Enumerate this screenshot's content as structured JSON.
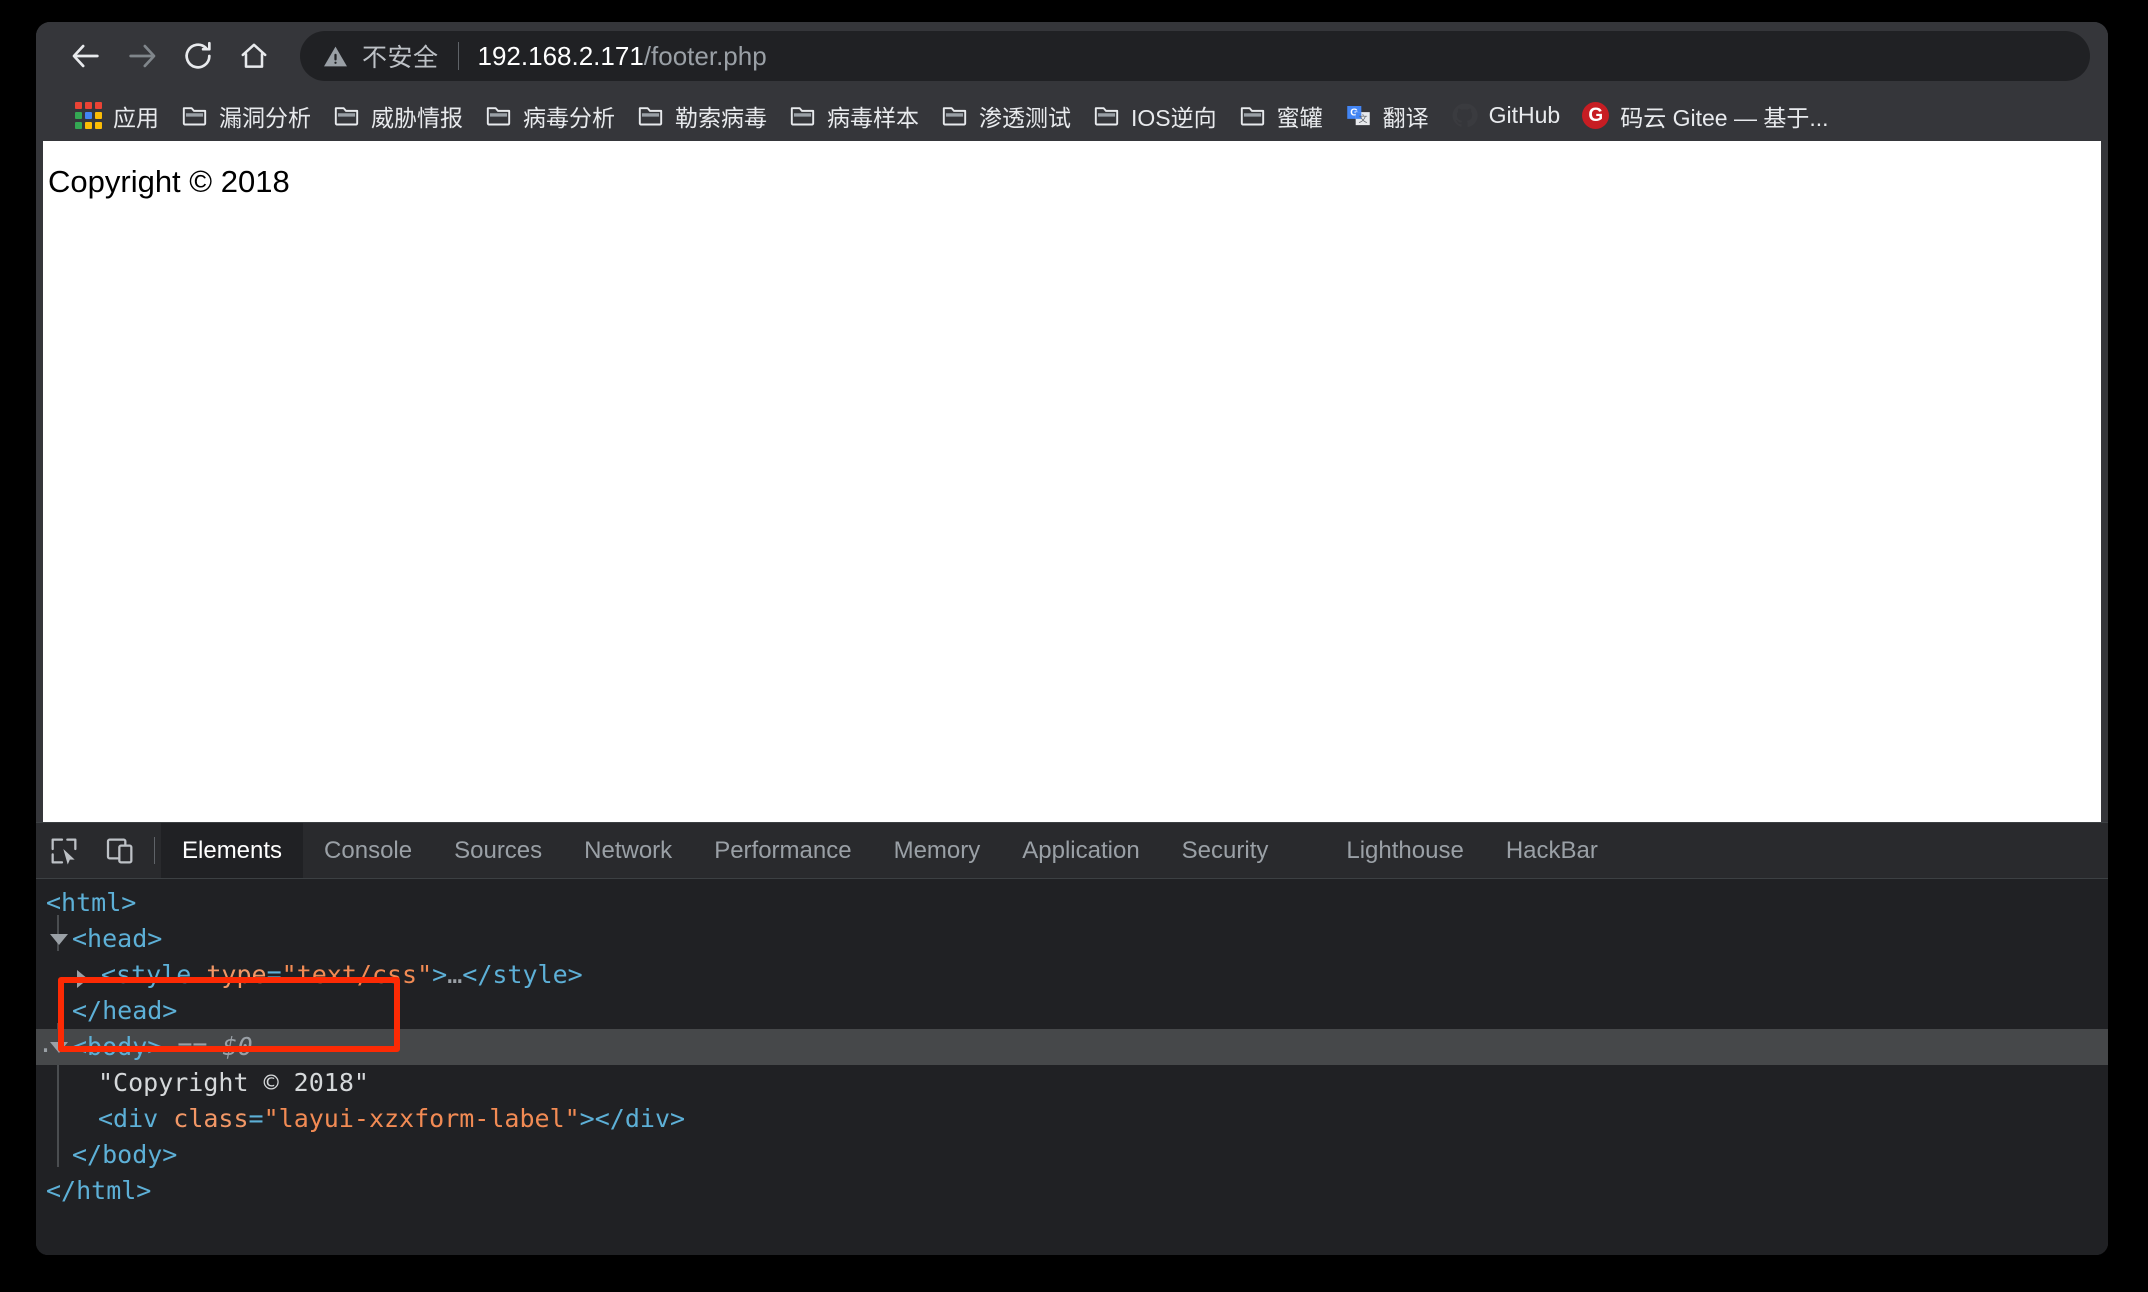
{
  "browser": {
    "nav": {
      "back_label": "Back",
      "forward_label": "Forward",
      "reload_label": "Reload",
      "home_label": "Home"
    },
    "omnibox": {
      "security_icon": "warning-triangle-icon",
      "security_text": "不安全",
      "url_host": "192.168.2.171",
      "url_path": "/footer.php"
    },
    "bookmarks": [
      {
        "label": "应用",
        "icon": "apps-grid-icon"
      },
      {
        "label": "漏洞分析",
        "icon": "folder-icon"
      },
      {
        "label": "威胁情报",
        "icon": "folder-icon"
      },
      {
        "label": "病毒分析",
        "icon": "folder-icon"
      },
      {
        "label": "勒索病毒",
        "icon": "folder-icon"
      },
      {
        "label": "病毒样本",
        "icon": "folder-icon"
      },
      {
        "label": "渗透测试",
        "icon": "folder-icon"
      },
      {
        "label": "IOS逆向",
        "icon": "folder-icon"
      },
      {
        "label": "蜜罐",
        "icon": "folder-icon"
      },
      {
        "label": "翻译",
        "icon": "google-translate-icon"
      },
      {
        "label": "GitHub",
        "icon": "github-icon"
      },
      {
        "label": "码云 Gitee — 基于...",
        "icon": "gitee-icon"
      }
    ]
  },
  "page": {
    "copyright": "Copyright © 2018"
  },
  "devtools": {
    "inspect_icon": "inspect-cursor-icon",
    "device_icon": "device-toolbar-icon",
    "tabs": [
      {
        "label": "Elements",
        "active": true
      },
      {
        "label": "Console",
        "active": false
      },
      {
        "label": "Sources",
        "active": false
      },
      {
        "label": "Network",
        "active": false
      },
      {
        "label": "Performance",
        "active": false
      },
      {
        "label": "Memory",
        "active": false
      },
      {
        "label": "Application",
        "active": false
      },
      {
        "label": "Security",
        "active": false
      },
      {
        "label": "Lighthouse",
        "active": false
      },
      {
        "label": "HackBar",
        "active": false
      }
    ],
    "dom": {
      "row_html_open": "<html>",
      "row_head_open": "<head>",
      "row_style": "<style type=\"text/css\">…</style>",
      "style_tag_open": "<style ",
      "style_attr_name": "type",
      "style_attr_eq": "=",
      "style_attr_value": "\"text/css\"",
      "style_tag_close_gt": ">",
      "style_ellipsis": "…",
      "style_end_tag": "</style>",
      "row_head_close": "</head>",
      "row_body_open": "<body>",
      "row_body_marker": "== $0",
      "row_text_node": "\"Copyright © 2018\"",
      "div_open": "<div ",
      "div_attr_name": "class",
      "div_attr_eq": "=",
      "div_attr_value": "\"layui-xzxform-label\"",
      "div_gt": ">",
      "div_close": "</div>",
      "row_body_close": "</body>",
      "row_html_close": "</html>"
    },
    "annotation": {
      "shape": "red-rectangle-highlight",
      "color": "#fc2a04"
    }
  },
  "colors": {
    "toolbar_bg": "#35363a",
    "omnibox_bg": "#202124",
    "devtools_bg": "#202124",
    "devtools_tabbar_bg": "#292a2d",
    "selected_row_bg": "#46484a",
    "annotation_red": "#fc2a04",
    "tag_blue": "#5db0d7",
    "attr_orange": "#f29766"
  }
}
